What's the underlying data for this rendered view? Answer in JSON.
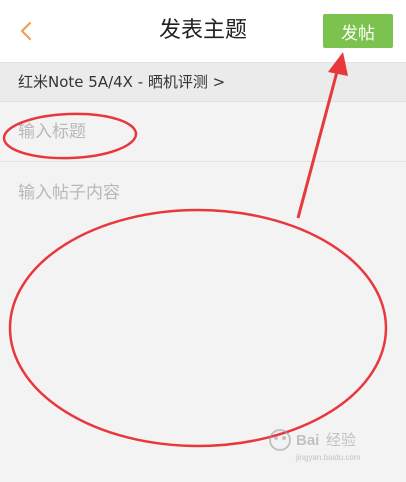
{
  "navbar": {
    "title": "发表主题",
    "post_label": "发帖",
    "back_icon": "chevron-left-icon",
    "accent_color": "#7cc24f",
    "back_color": "#f0a05a"
  },
  "category": {
    "label": "红米Note 5A/4X - 晒机评测 >"
  },
  "form": {
    "title_placeholder": "输入标题",
    "content_placeholder": "输入帖子内容"
  },
  "annotation_color": "#e8383c",
  "watermark": {
    "text": "Baidu经验",
    "url_text": "jingyan.baidu.com"
  }
}
